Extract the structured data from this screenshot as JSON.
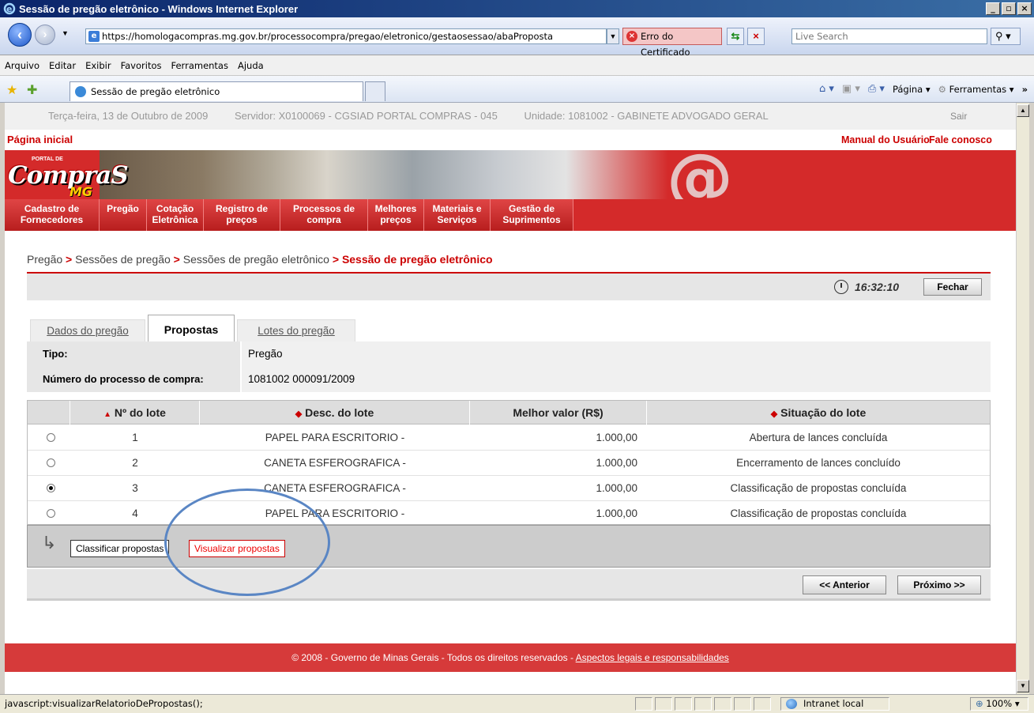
{
  "window": {
    "title": "Sessão de pregão eletrônico - Windows Internet Explorer"
  },
  "addressbar": {
    "url": "https://homologacompras.mg.gov.br/processocompra/pregao/eletronico/gestaosessao/abaProposta",
    "cert_error": "Erro do Certificado",
    "search_placeholder": "Live Search"
  },
  "menubar": {
    "items": [
      "Arquivo",
      "Editar",
      "Exibir",
      "Favoritos",
      "Ferramentas",
      "Ajuda"
    ]
  },
  "browser_tab": {
    "label": "Sessão de pregão eletrônico"
  },
  "commandbar": {
    "pagina": "Página",
    "ferramentas": "Ferramentas"
  },
  "sysinfo": {
    "date": "Terça-feira, 13 de Outubro de 2009",
    "server": "Servidor: X0100069 - CGSIAD PORTAL COMPRAS - 045",
    "unit": "Unidade: 1081002 - GABINETE ADVOGADO GERAL",
    "logout": "Sair"
  },
  "topnav": {
    "home": "Página inicial",
    "manual": "Manual do Usuário",
    "contact": "Fale conosco"
  },
  "banner": {
    "logo_top": "PORTAL DE",
    "logo_main": "CompraS",
    "logo_sub": "MG"
  },
  "mainmenu": {
    "items": [
      {
        "l1": "Cadastro de",
        "l2": "Fornecedores"
      },
      {
        "l1": "Pregão",
        "l2": ""
      },
      {
        "l1": "Cotação",
        "l2": "Eletrônica"
      },
      {
        "l1": "Registro de",
        "l2": "preços"
      },
      {
        "l1": "Processos de",
        "l2": "compra"
      },
      {
        "l1": "Melhores",
        "l2": "preços"
      },
      {
        "l1": "Materiais e",
        "l2": "Serviços"
      },
      {
        "l1": "Gestão de",
        "l2": "Suprimentos"
      }
    ]
  },
  "breadcrumb": {
    "items": [
      "Pregão",
      "Sessões de pregão",
      "Sessões de pregão eletrônico"
    ],
    "current": "Sessão de pregão eletrônico",
    "sep": ">"
  },
  "timebar": {
    "time": "16:32:10",
    "close": "Fechar"
  },
  "tabs": {
    "items": [
      "Dados do pregão",
      "Propostas",
      "Lotes do pregão"
    ],
    "active": "Propostas"
  },
  "info": {
    "rows": [
      {
        "label": "Tipo:",
        "value": "Pregão"
      },
      {
        "label": "Número do processo de compra:",
        "value": "1081002 000091/2009"
      }
    ]
  },
  "lotes": {
    "headers": [
      "Nº do lote",
      "Desc. do lote",
      "Melhor valor (R$)",
      "Situação do lote"
    ],
    "rows": [
      {
        "num": "1",
        "desc": "PAPEL PARA ESCRITORIO -",
        "valor": "1.000,00",
        "situacao": "Abertura de lances concluída",
        "selected": false
      },
      {
        "num": "2",
        "desc": "CANETA ESFEROGRAFICA -",
        "valor": "1.000,00",
        "situacao": "Encerramento de lances concluído",
        "selected": false
      },
      {
        "num": "3",
        "desc": "CANETA ESFEROGRAFICA -",
        "valor": "1.000,00",
        "situacao": "Classificação de propostas concluída",
        "selected": true
      },
      {
        "num": "4",
        "desc": "PAPEL PARA ESCRITORIO -",
        "valor": "1.000,00",
        "situacao": "Classificação de propostas concluída",
        "selected": false
      }
    ]
  },
  "actions": {
    "classify": "Classificar propostas",
    "view": "Visualizar propostas"
  },
  "pager": {
    "prev": "<< Anterior",
    "next": "Próximo >>"
  },
  "footer": {
    "text": "© 2008 - Governo de Minas Gerais - Todos os direitos reservados - ",
    "link": "Aspectos legais e responsabilidades"
  },
  "statusbar": {
    "message": "javascript:visualizarRelatorioDePropostas();",
    "zone": "Intranet local",
    "zoom": "100%"
  },
  "colors": {
    "brand_red": "#d42a2a",
    "link_red": "#cc0000"
  }
}
